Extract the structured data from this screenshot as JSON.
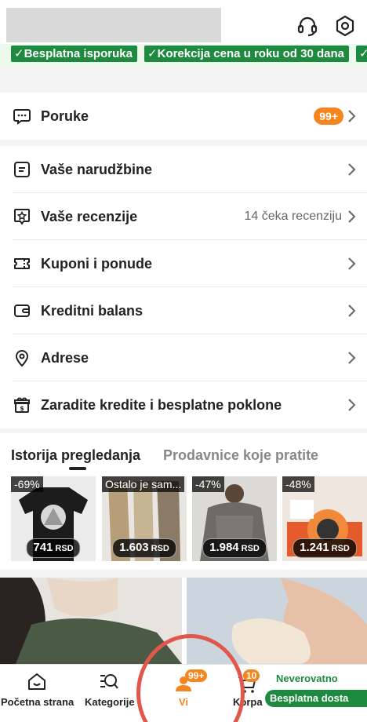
{
  "header": {
    "support_icon": "headset-icon",
    "settings_icon": "settings-icon"
  },
  "benefits": [
    "✓Besplatna isporuka",
    "✓Korekcija cena u roku od 30 dana",
    "✓"
  ],
  "menu": {
    "messages": {
      "label": "Poruke",
      "badge": "99+",
      "icon": "chat-icon"
    },
    "orders": {
      "label": "Vaše narudžbine",
      "icon": "orders-icon"
    },
    "reviews": {
      "label": "Vaše recenzije",
      "info": "14 čeka recenziju",
      "icon": "review-icon"
    },
    "coupons": {
      "label": "Kuponi i ponude",
      "icon": "coupon-icon"
    },
    "credit": {
      "label": "Kreditni balans",
      "icon": "wallet-icon"
    },
    "addresses": {
      "label": "Adrese",
      "icon": "location-pin-icon"
    },
    "earn": {
      "label": "Zaradite kredite i besplatne poklone",
      "icon": "gift-icon"
    }
  },
  "tabs": {
    "history": "Istorija pregledanja",
    "followed": "Prodavnice koje pratite"
  },
  "history_items": [
    {
      "tag": "-69%",
      "price": "741",
      "currency": "RSD"
    },
    {
      "tag": "Ostalo je sam...",
      "price": "1.603",
      "currency": "RSD"
    },
    {
      "tag": "-47%",
      "price": "1.984",
      "currency": "RSD"
    },
    {
      "tag": "-48%",
      "price": "1.241",
      "currency": "RSD"
    }
  ],
  "bottom_nav": {
    "home": "Početna strana",
    "categories": "Kategorije",
    "you": "Vi",
    "you_badge": "99+",
    "cart": "Korpa",
    "cart_badge": "10",
    "promo_line": "Neverovatno",
    "promo_pill": "Besplatna dosta"
  },
  "colors": {
    "accent_orange": "#f5861f",
    "green": "#1d8a3f",
    "annotation_red": "#e2574c"
  }
}
